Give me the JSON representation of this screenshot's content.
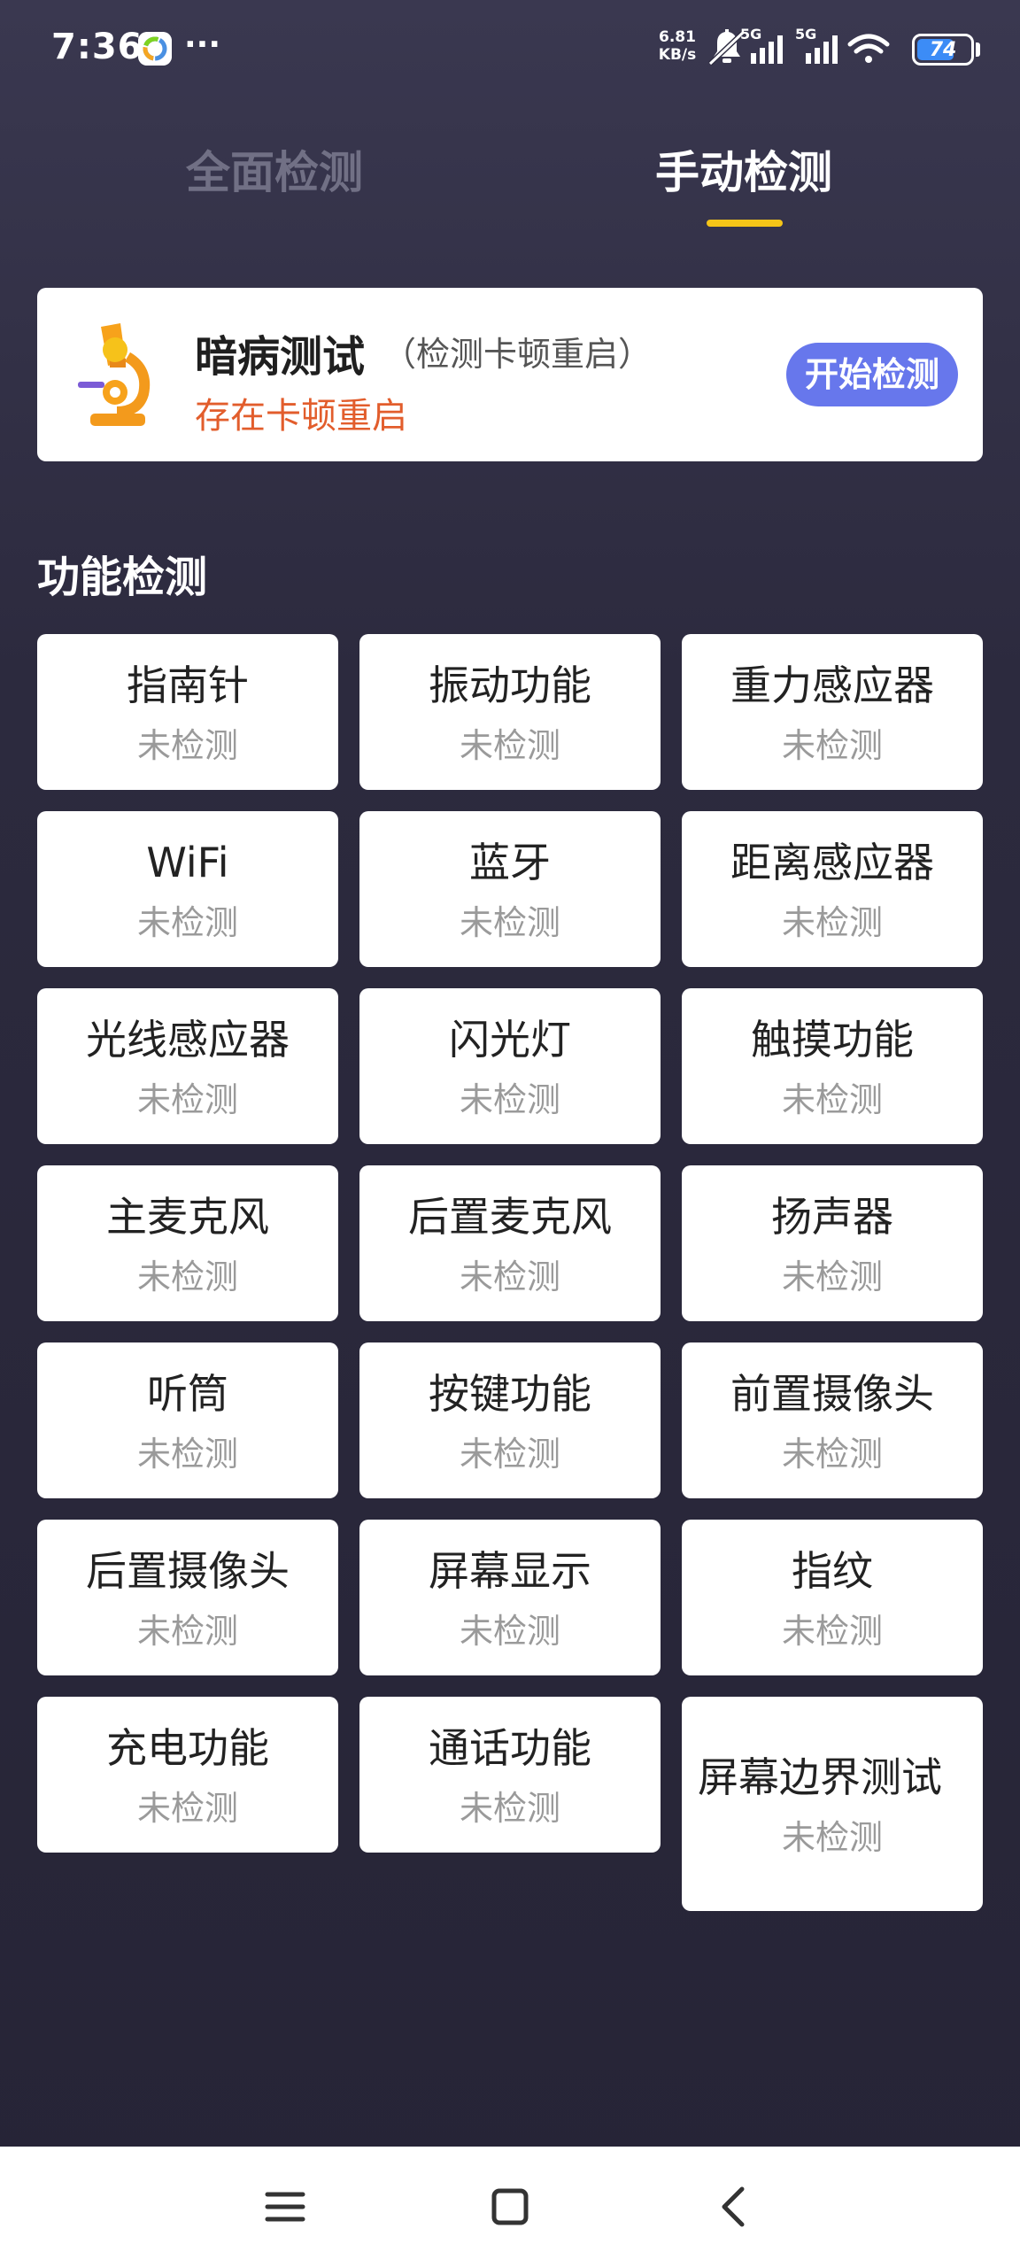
{
  "status_bar": {
    "time": "7:36",
    "dots": "···",
    "net_speed_value": "6.81",
    "net_speed_unit": "KB/s",
    "signal_1_label": "5G",
    "signal_2_label": "5G",
    "battery": "74",
    "battery_level": 0.74,
    "icons": [
      "app-icon",
      "bell-muted-icon",
      "signal-icon",
      "signal-icon",
      "wifi-icon",
      "battery-icon"
    ]
  },
  "tabs": [
    {
      "label": "全面检测",
      "selected": false
    },
    {
      "label": "手动检测",
      "selected": true
    }
  ],
  "hidden_issue": {
    "title": "暗病测试",
    "subtitle": "（检测卡顿重启）",
    "status": "存在卡顿重启",
    "button": "开始检测",
    "icon": "microscope-icon"
  },
  "section_title": "功能检测",
  "tiles": [
    {
      "name": "指南针",
      "status": "未检测"
    },
    {
      "name": "振动功能",
      "status": "未检测"
    },
    {
      "name": "重力感应器",
      "status": "未检测"
    },
    {
      "name": "WiFi",
      "status": "未检测"
    },
    {
      "name": "蓝牙",
      "status": "未检测"
    },
    {
      "name": "距离感应器",
      "status": "未检测"
    },
    {
      "name": "光线感应器",
      "status": "未检测"
    },
    {
      "name": "闪光灯",
      "status": "未检测"
    },
    {
      "name": "触摸功能",
      "status": "未检测"
    },
    {
      "name": "主麦克风",
      "status": "未检测"
    },
    {
      "name": "后置麦克风",
      "status": "未检测"
    },
    {
      "name": "扬声器",
      "status": "未检测"
    },
    {
      "name": "听筒",
      "status": "未检测"
    },
    {
      "name": "按键功能",
      "status": "未检测"
    },
    {
      "name": "前置摄像头",
      "status": "未检测"
    },
    {
      "name": "后置摄像头",
      "status": "未检测"
    },
    {
      "name": "屏幕显示",
      "status": "未检测"
    },
    {
      "name": "指纹",
      "status": "未检测"
    },
    {
      "name": "充电功能",
      "status": "未检测"
    },
    {
      "name": "通话功能",
      "status": "未检测"
    },
    {
      "name": "屏幕边界测试",
      "status": "未检测"
    }
  ],
  "nav_bar": {
    "buttons": [
      "menu-icon",
      "home-icon",
      "back-icon"
    ]
  },
  "colors": {
    "background": "#2c2a3e",
    "tab_indicator": "#f5c518",
    "button": "#6777ec",
    "warning_text": "#e25d2c"
  }
}
